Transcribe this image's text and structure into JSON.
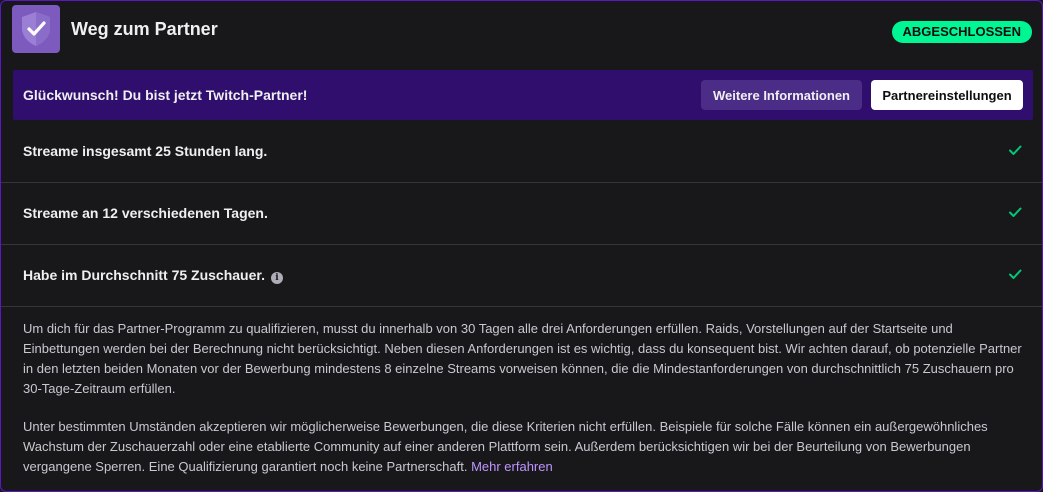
{
  "header": {
    "title": "Weg zum Partner",
    "status": "ABGESCHLOSSEN",
    "icon": "check-shield-icon"
  },
  "banner": {
    "message": "Glückwunsch! Du bist jetzt Twitch-Partner!",
    "more_info_label": "Weitere Informationen",
    "settings_label": "Partnereinstellungen"
  },
  "requirements": [
    {
      "label": "Streame insgesamt 25 Stunden lang.",
      "done": true
    },
    {
      "label": "Streame an 12 verschiedenen Tagen.",
      "done": true
    },
    {
      "label": "Habe im Durchschnitt 75 Zuschauer.",
      "done": true,
      "info_icon": "i"
    }
  ],
  "description": {
    "paragraph1": "Um dich für das Partner-Programm zu qualifizieren, musst du innerhalb von 30 Tagen alle drei Anforderungen erfüllen. Raids, Vorstellungen auf der Startseite und Einbettungen werden bei der Berechnung nicht berücksichtigt. Neben diesen Anforderungen ist es wichtig, dass du konsequent bist. Wir achten darauf, ob potenzielle Partner in den letzten beiden Monaten vor der Bewerbung mindestens 8 einzelne Streams vorweisen können, die die Mindestanforderungen von durchschnittlich 75 Zuschauern pro 30-Tage-Zeitraum erfüllen.",
    "paragraph2": "Unter bestimmten Umständen akzeptieren wir möglicherweise Bewerbungen, die diese Kriterien nicht erfüllen. Beispiele für solche Fälle können ein außergewöhnliches Wachstum der Zuschauerzahl oder eine etablierte Community auf einer anderen Plattform sein. Außerdem berücksichtigen wir bei der Beurteilung von Bewerbungen vergangene Sperren. Eine Qualifizierung garantiert noch keine Partnerschaft.",
    "link_label": "Mehr erfahren"
  },
  "colors": {
    "accent": "#9147ff",
    "banner_bg": "#2f0e6d",
    "success": "#00f593"
  }
}
